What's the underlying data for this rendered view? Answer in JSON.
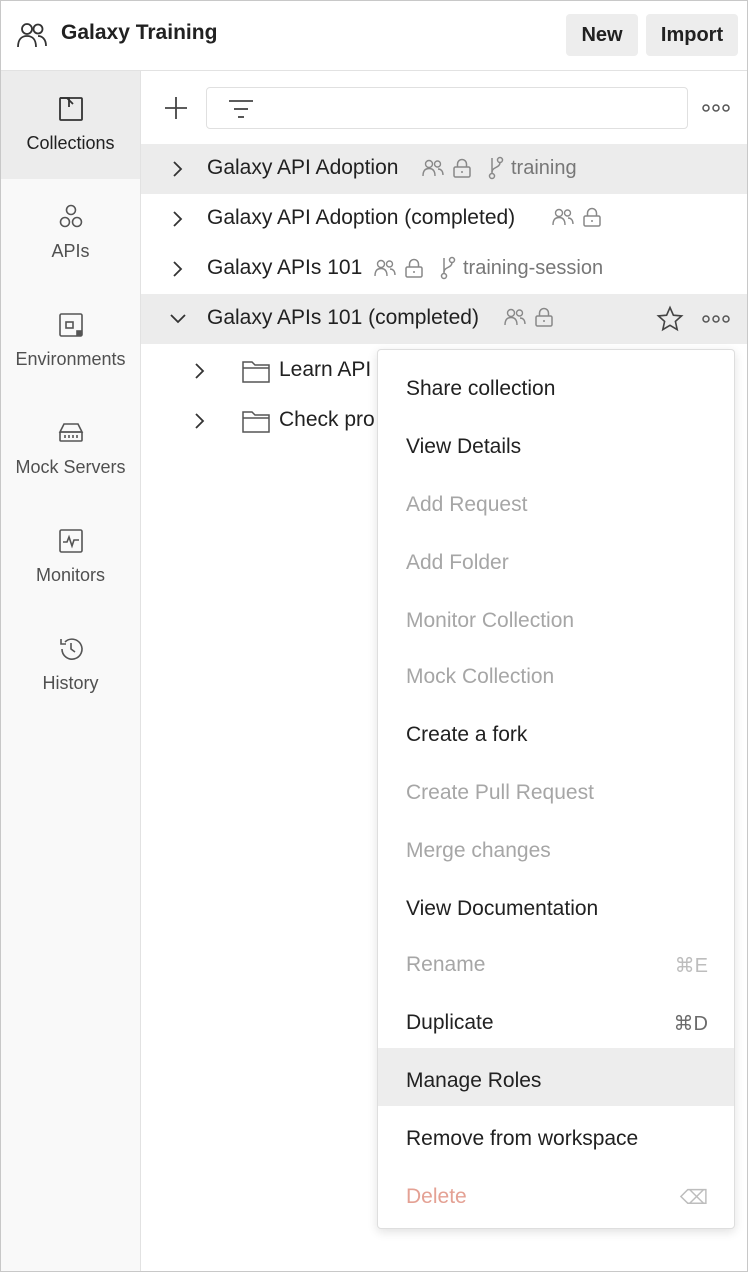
{
  "workspace": {
    "title": "Galaxy Training"
  },
  "header": {
    "new_label": "New",
    "import_label": "Import"
  },
  "sidebar": {
    "items": [
      {
        "label": "Collections",
        "icon": "collections-icon",
        "active": true
      },
      {
        "label": "APIs",
        "icon": "apis-icon",
        "active": false
      },
      {
        "label": "Environments",
        "icon": "environments-icon",
        "active": false
      },
      {
        "label": "Mock Servers",
        "icon": "mock-servers-icon",
        "active": false
      },
      {
        "label": "Monitors",
        "icon": "monitors-icon",
        "active": false
      },
      {
        "label": "History",
        "icon": "history-icon",
        "active": false
      }
    ]
  },
  "collections": [
    {
      "name": "Galaxy API Adoption",
      "branch": "training",
      "expanded": false
    },
    {
      "name": "Galaxy API Adoption (completed)",
      "branch": "",
      "expanded": false
    },
    {
      "name": "Galaxy APIs 101",
      "branch": "training-session",
      "expanded": false
    },
    {
      "name": "Galaxy APIs 101 (completed)",
      "branch": "",
      "expanded": true,
      "folders": [
        {
          "name": "Learn API"
        },
        {
          "name": "Check pro"
        }
      ]
    }
  ],
  "context_menu": {
    "items": [
      {
        "label": "Share collection",
        "shortcut": "",
        "state": "enabled"
      },
      {
        "label": "View Details",
        "shortcut": "",
        "state": "enabled"
      },
      {
        "label": "Add Request",
        "shortcut": "",
        "state": "disabled"
      },
      {
        "label": "Add Folder",
        "shortcut": "",
        "state": "disabled"
      },
      {
        "label": "Monitor Collection",
        "shortcut": "",
        "state": "disabled"
      },
      {
        "label": "Mock Collection",
        "shortcut": "",
        "state": "disabled"
      },
      {
        "label": "Create a fork",
        "shortcut": "",
        "state": "enabled"
      },
      {
        "label": "Create Pull Request",
        "shortcut": "",
        "state": "disabled"
      },
      {
        "label": "Merge changes",
        "shortcut": "",
        "state": "disabled"
      },
      {
        "label": "View Documentation",
        "shortcut": "",
        "state": "enabled"
      },
      {
        "label": "Rename",
        "shortcut": "⌘E",
        "state": "disabled"
      },
      {
        "label": "Duplicate",
        "shortcut": "⌘D",
        "state": "enabled"
      },
      {
        "label": "Manage Roles",
        "shortcut": "",
        "state": "hover"
      },
      {
        "label": "Remove from workspace",
        "shortcut": "",
        "state": "enabled"
      },
      {
        "label": "Delete",
        "shortcut": "⌫",
        "state": "danger"
      }
    ]
  },
  "colors": {
    "active_bg": "#ececec",
    "sidebar_bg": "#f9f9f9",
    "disabled_text": "#a6a6a6",
    "danger_text": "#e4a194"
  }
}
